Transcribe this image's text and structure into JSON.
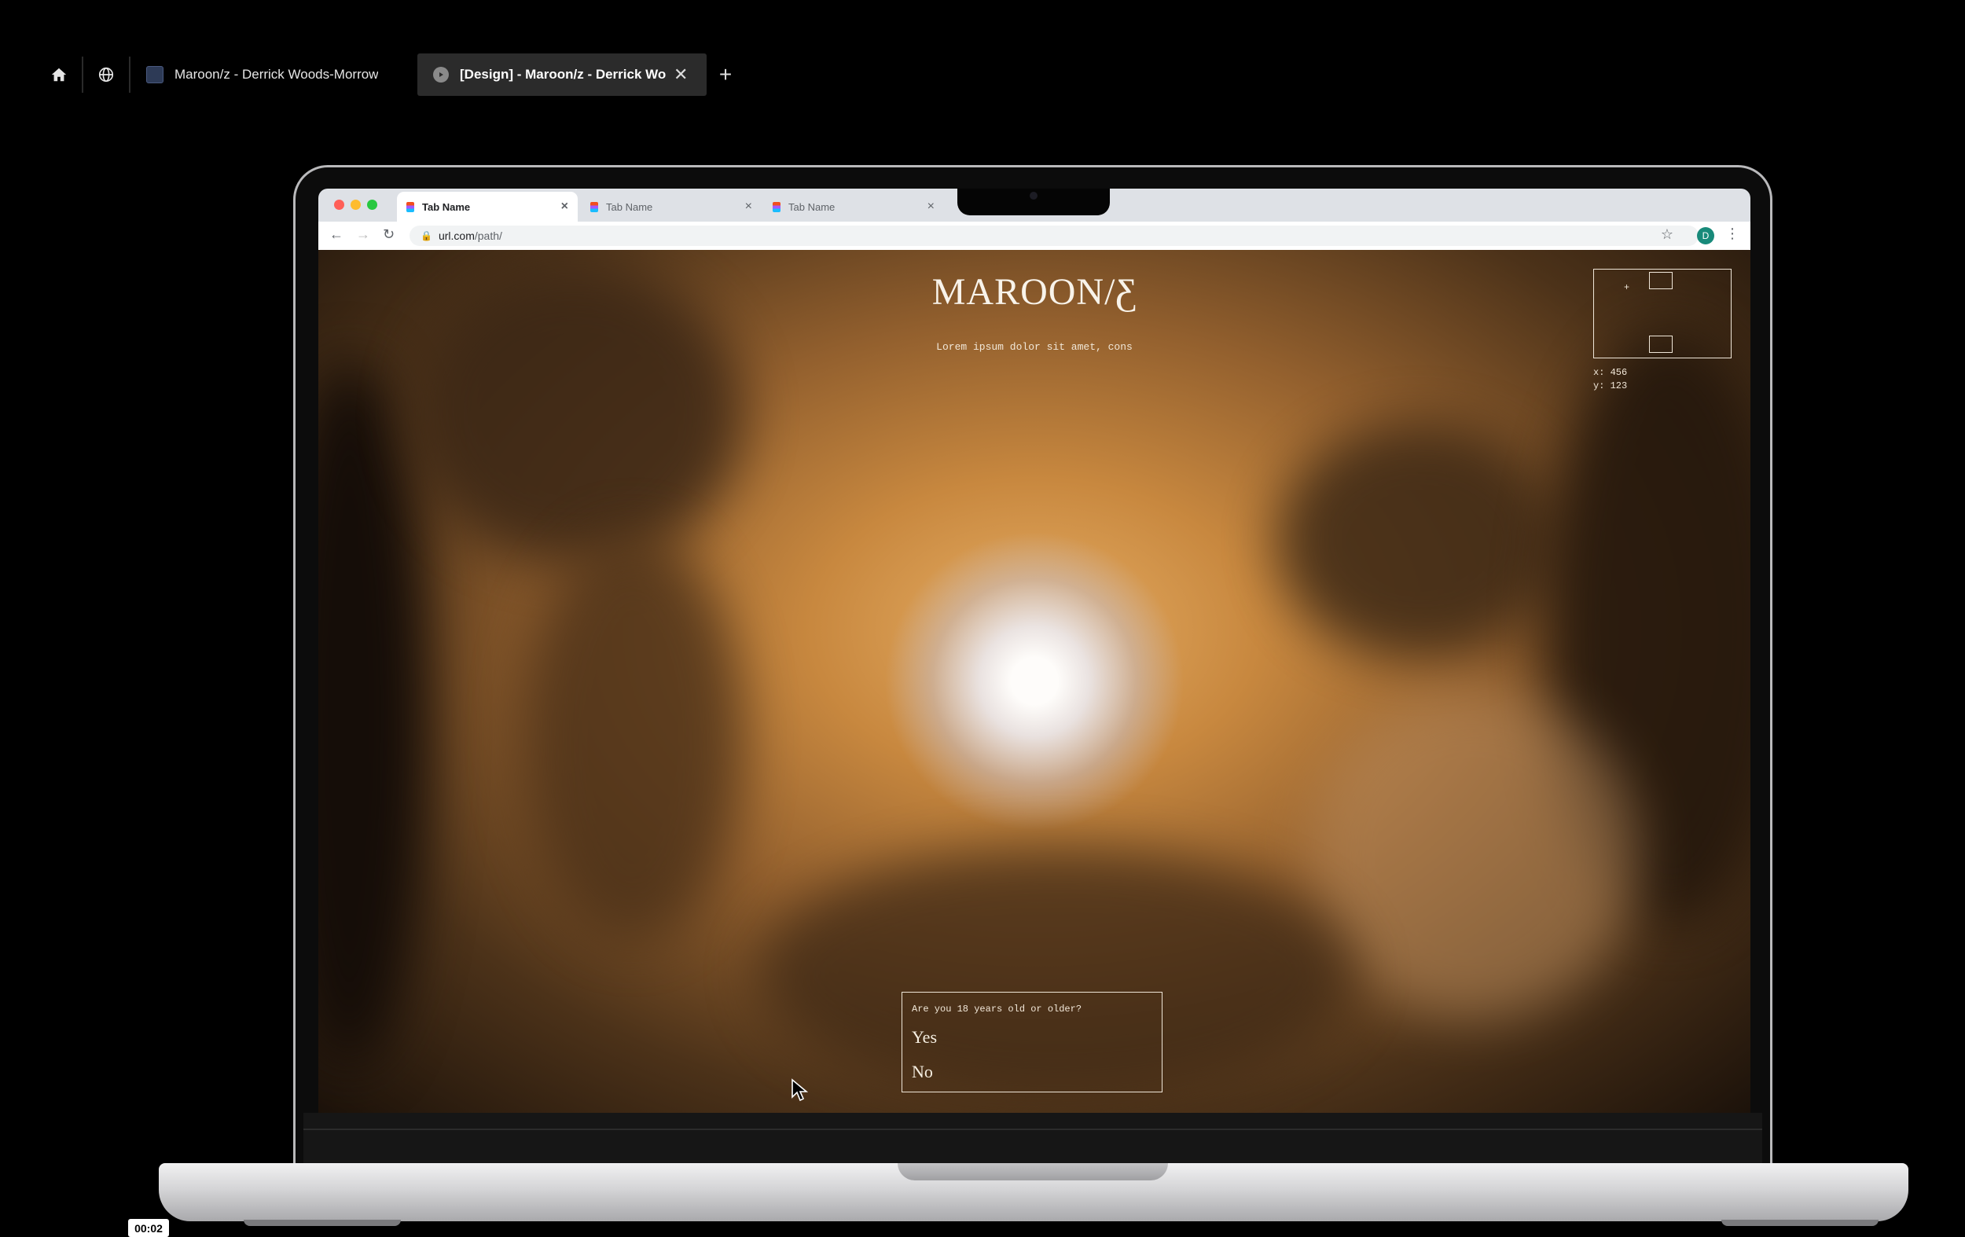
{
  "app_tabs": [
    {
      "label": "Maroon/z - Derrick Woods-Morrow",
      "icon": "figma-file-icon",
      "active": false
    },
    {
      "label": "[Design] - Maroon/z - Derrick Woods-Morrow",
      "icon": "play-icon",
      "active": true
    }
  ],
  "browser": {
    "tabs": [
      {
        "label": "Tab Name",
        "active": true
      },
      {
        "label": "Tab Name",
        "active": false
      },
      {
        "label": "Tab Name",
        "active": false
      }
    ],
    "url_host": "url.com",
    "url_path": "/path/",
    "profile_initial": "D"
  },
  "site": {
    "title": "MAROON/Ƹ",
    "subtitle": "Lorem ipsum dolor sit amet, cons",
    "coords": {
      "x_label": "x: 456",
      "y_label": "y: 123"
    },
    "age_gate": {
      "question": "Are you 18 years old or older?",
      "yes": "Yes",
      "no": "No"
    }
  },
  "player": {
    "timestamp": "00:02"
  },
  "colors": {
    "background": "#000000",
    "active_app_tab": "#2b2b2b",
    "chrome_tabstrip": "#dee1e6",
    "hero_warm": "#c8883f",
    "overlay_text": "#efe6d8"
  }
}
